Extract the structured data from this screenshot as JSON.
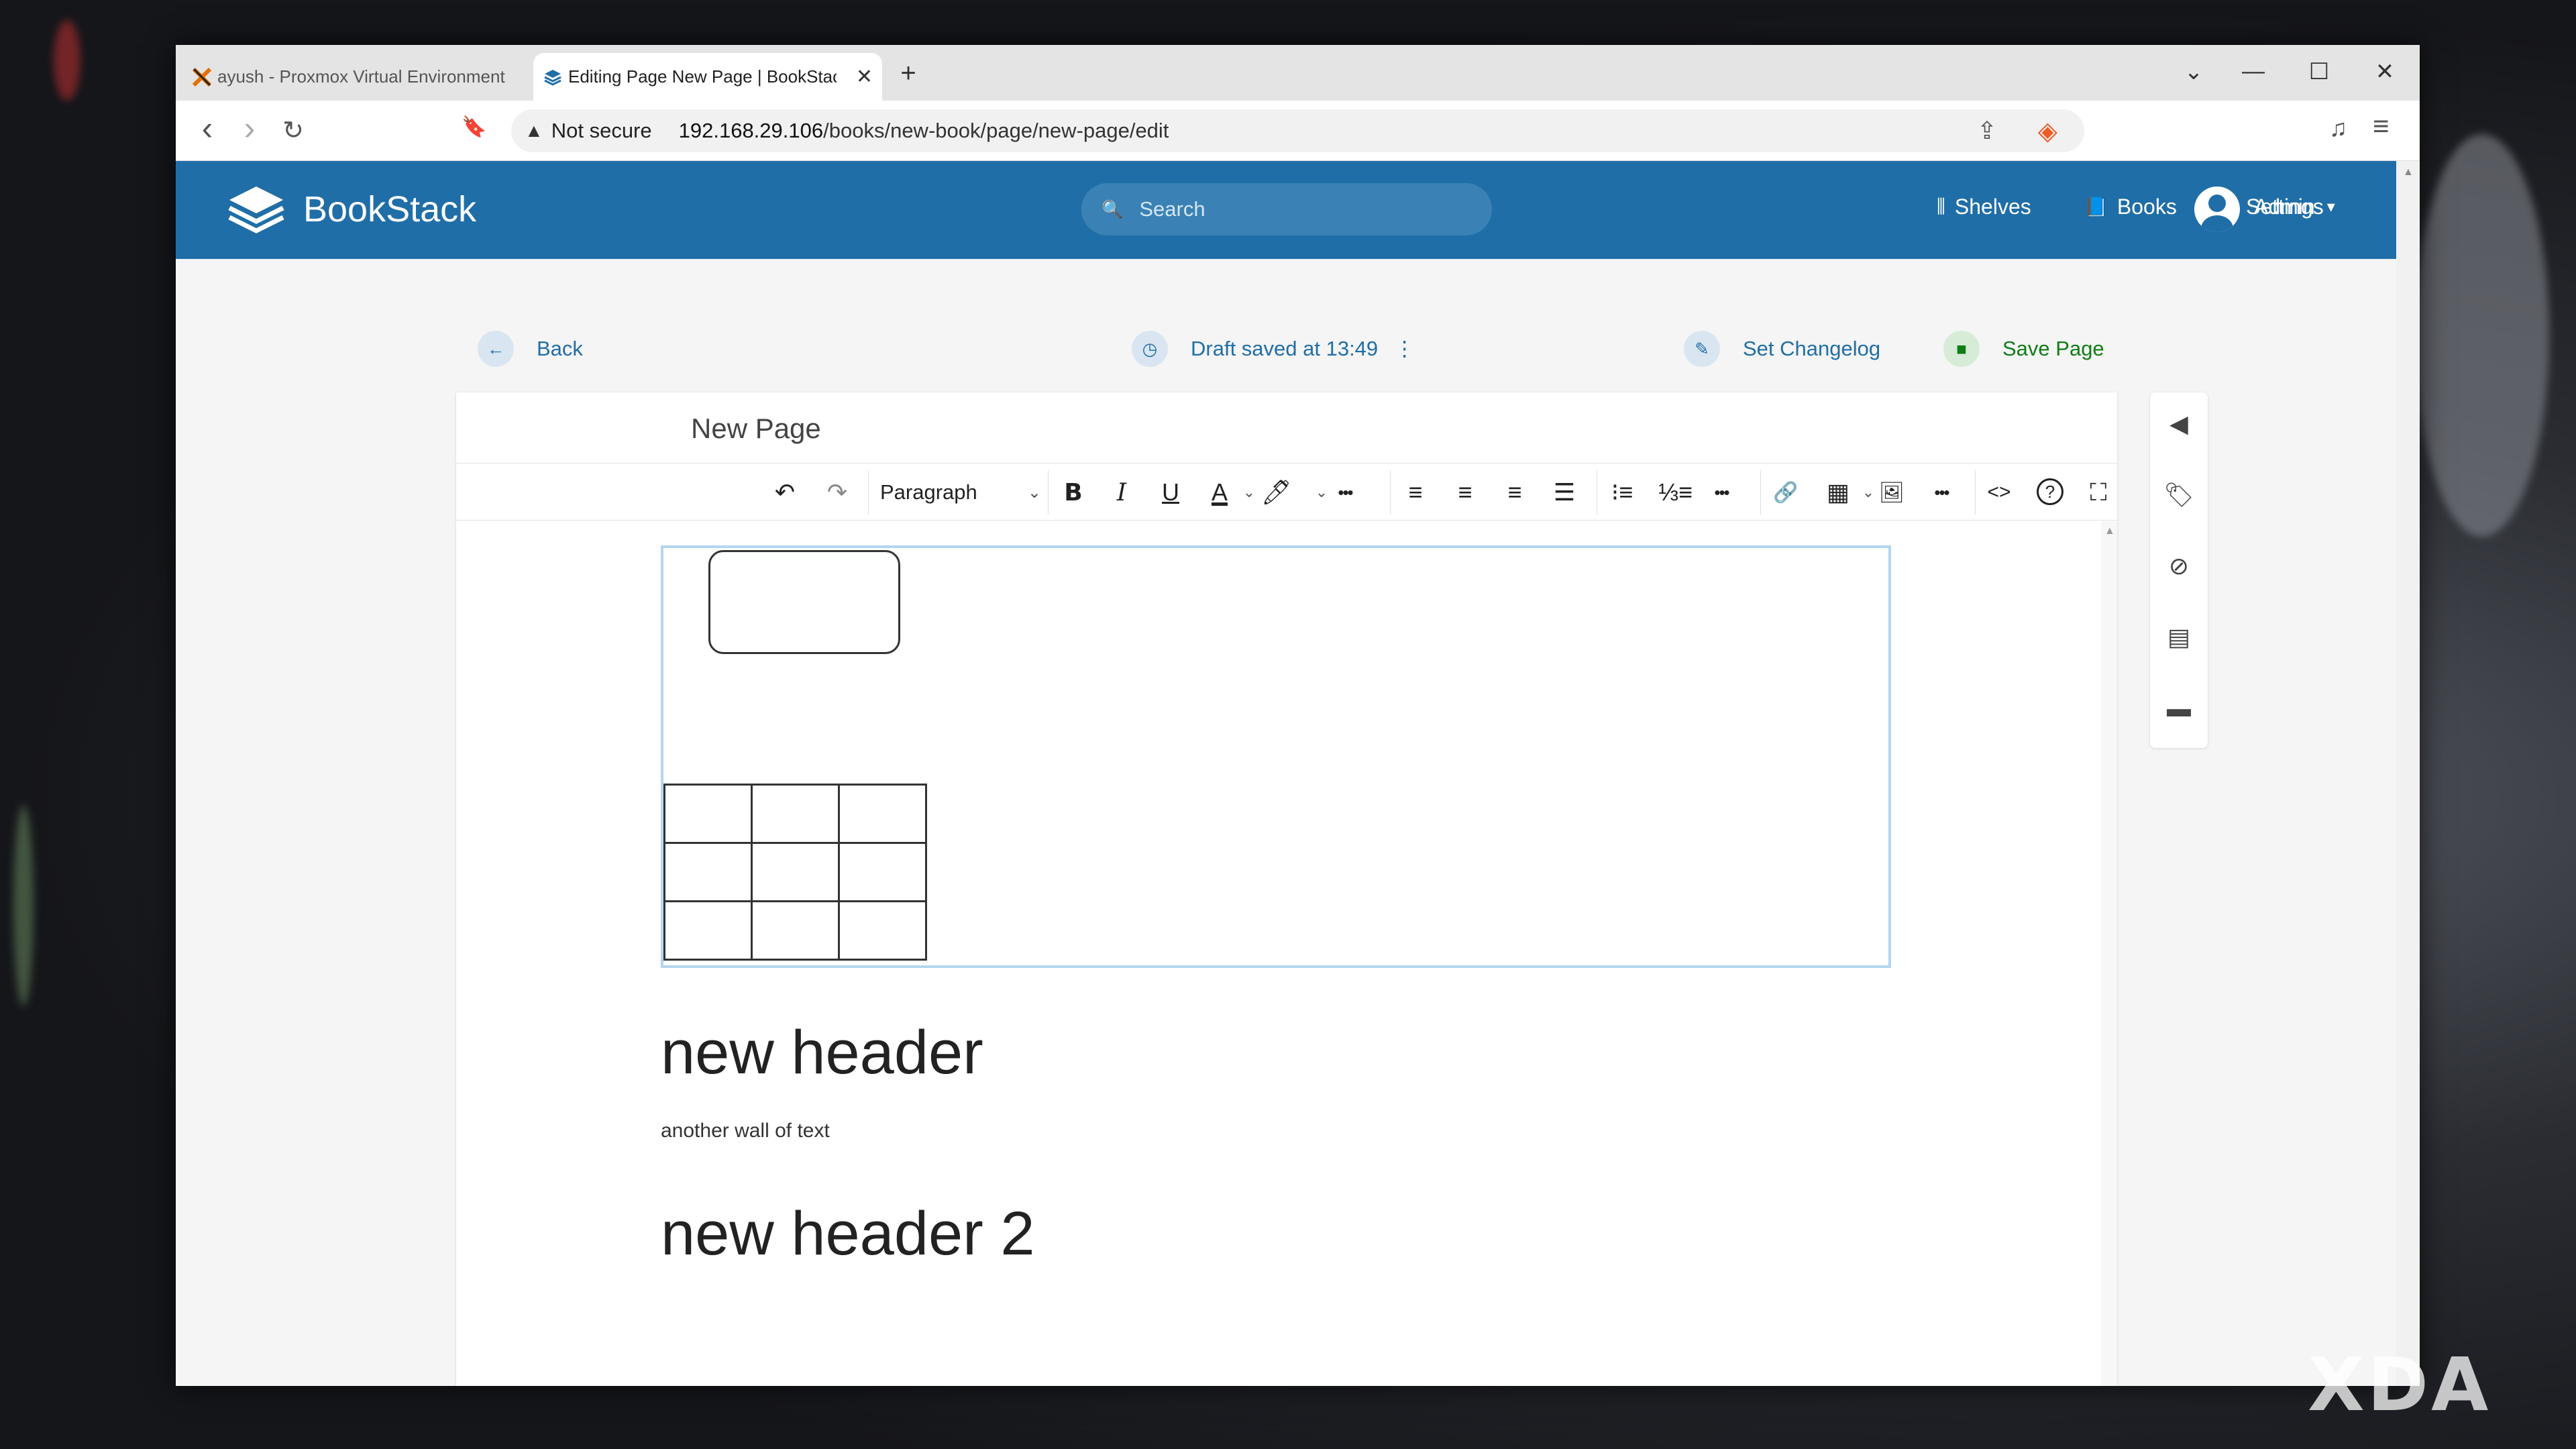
{
  "browser": {
    "tabs": [
      {
        "label": "ayush - Proxmox Virtual Environment",
        "favicon": "proxmox-icon"
      },
      {
        "label": "Editing Page New Page | BookStack",
        "favicon": "bookstack-icon",
        "active": true
      }
    ],
    "close_glyph": "✕",
    "new_tab_glyph": "+",
    "window_controls": {
      "tabs_list": "⌄",
      "minimize": "—",
      "maximize": "☐",
      "close": "✕"
    },
    "nav": {
      "back": "‹",
      "forward": "›",
      "reload": "↻",
      "bookmark": "🔖"
    },
    "security": "Not secure",
    "url_host": "192.168.29.106",
    "url_path": "/books/new-book/page/new-page/edit",
    "right_tools": {
      "share": "⇪",
      "shield": "🦁",
      "media": "♫",
      "menu": "≡"
    }
  },
  "app": {
    "brand": "BookStack",
    "search_placeholder": "Search",
    "nav": {
      "shelves": "Shelves",
      "books": "Books",
      "settings": "Settings",
      "user": "Admin"
    },
    "icons": {
      "shelves": "⫼",
      "books": "📘",
      "settings": "⚙",
      "caret": "▾",
      "search": "🔍"
    },
    "accent": "#206ea7"
  },
  "actions": {
    "back": "Back",
    "draft": "Draft saved at 13:49",
    "draft_menu": "⋮",
    "changelog": "Set Changelog",
    "save": "Save Page"
  },
  "editor": {
    "page_title": "New Page",
    "format_select": "Paragraph",
    "toolbar": {
      "undo": "↶",
      "redo": "↷",
      "bold": "B",
      "italic": "I",
      "underline": "U",
      "more": "•••",
      "link": "🔗",
      "table": "▦",
      "image": "🖼",
      "code": "<>",
      "help": "?",
      "fullscreen": "⛶"
    },
    "content": {
      "heading1": "new header",
      "paragraph": "another wall of text",
      "heading2": "new header 2"
    }
  },
  "watermark": "XDA"
}
